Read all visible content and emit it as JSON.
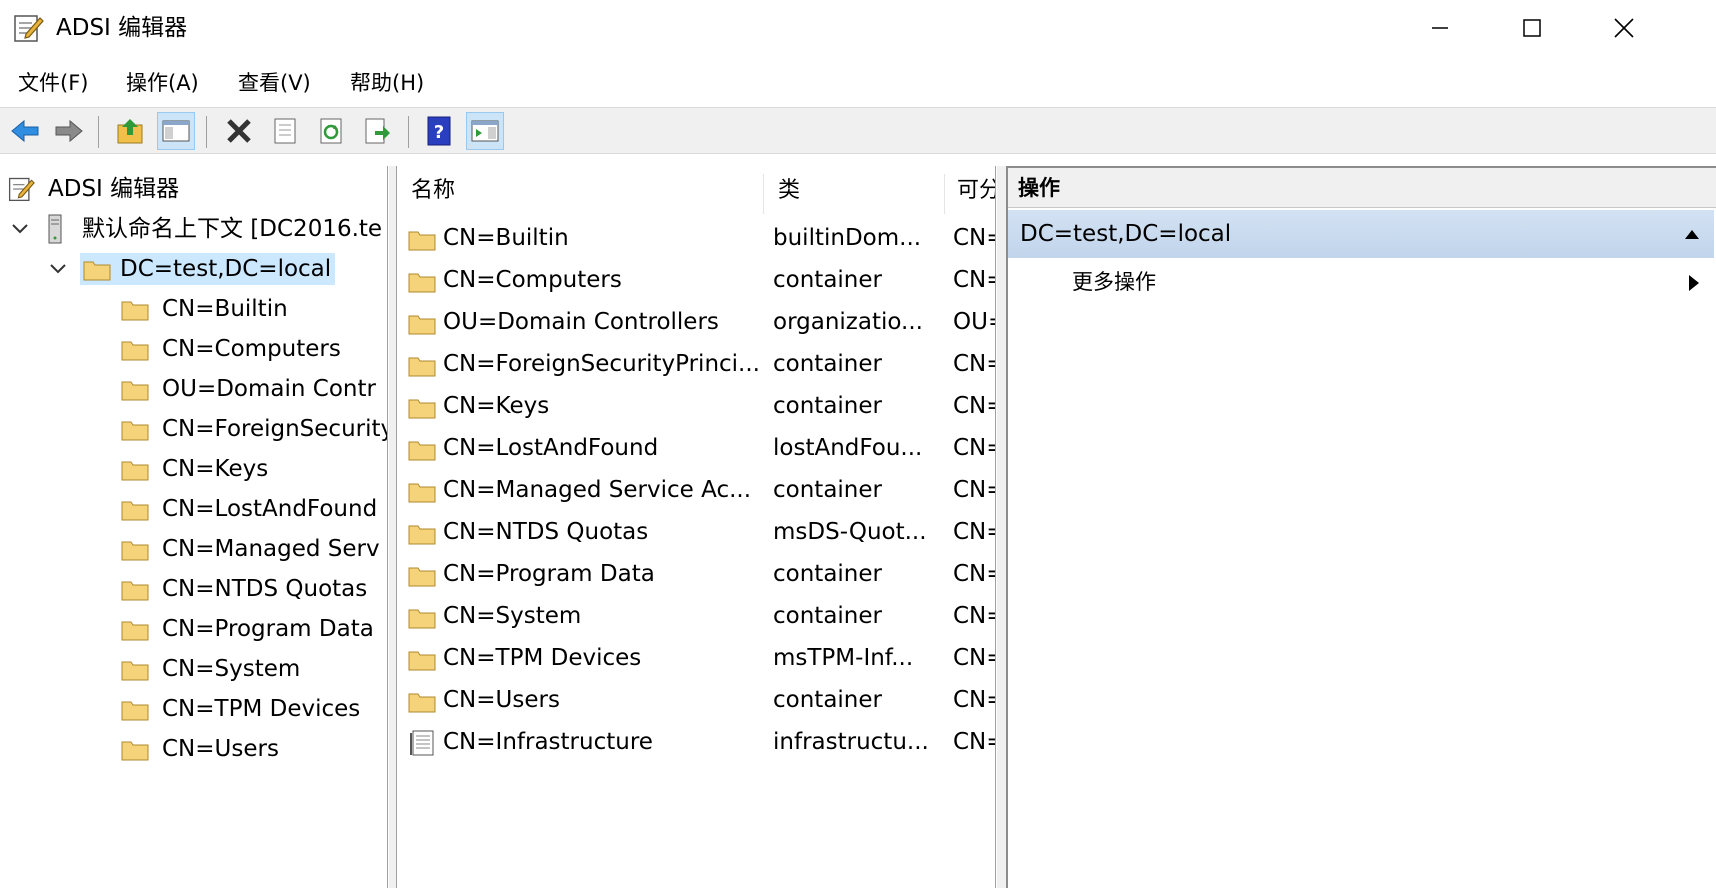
{
  "window": {
    "title": "ADSI 编辑器",
    "icons": {
      "app": "adsi-editor-icon",
      "minimize": "minimize-icon",
      "maximize": "maximize-icon",
      "close": "close-icon"
    }
  },
  "menu": {
    "items": [
      {
        "label": "文件(F)"
      },
      {
        "label": "操作(A)"
      },
      {
        "label": "查看(V)"
      },
      {
        "label": "帮助(H)"
      }
    ]
  },
  "toolbar": {
    "buttons": [
      {
        "icon": "back-arrow-icon"
      },
      {
        "icon": "forward-arrow-icon"
      },
      {
        "icon": "up-folder-icon"
      },
      {
        "icon": "show-hide-console-tree-icon",
        "active": true
      },
      {
        "icon": "delete-x-icon"
      },
      {
        "icon": "properties-icon"
      },
      {
        "icon": "refresh-icon"
      },
      {
        "icon": "export-list-icon"
      },
      {
        "icon": "help-icon"
      },
      {
        "icon": "show-hide-action-pane-icon",
        "active": true
      }
    ]
  },
  "tree": {
    "root": {
      "label": "ADSI 编辑器",
      "icon": "adsi-editor-icon"
    },
    "context": {
      "label": "默认命名上下文 [DC2016.te",
      "icon": "server-icon"
    },
    "domain": {
      "label": "DC=test,DC=local",
      "icon": "folder-icon",
      "selected": true
    },
    "children": [
      {
        "label": "CN=Builtin"
      },
      {
        "label": "CN=Computers"
      },
      {
        "label": "OU=Domain Contr"
      },
      {
        "label": "CN=ForeignSecurity"
      },
      {
        "label": "CN=Keys"
      },
      {
        "label": "CN=LostAndFound"
      },
      {
        "label": "CN=Managed Serv"
      },
      {
        "label": "CN=NTDS Quotas"
      },
      {
        "label": "CN=Program Data"
      },
      {
        "label": "CN=System"
      },
      {
        "label": "CN=TPM Devices"
      },
      {
        "label": "CN=Users"
      }
    ]
  },
  "list": {
    "columns": [
      {
        "label": "名称"
      },
      {
        "label": "类"
      },
      {
        "label": "可分"
      }
    ],
    "rows": [
      {
        "name": "CN=Builtin",
        "class": "builtinDom...",
        "dn": "CN=",
        "icon": "folder-icon"
      },
      {
        "name": "CN=Computers",
        "class": "container",
        "dn": "CN=",
        "icon": "folder-icon"
      },
      {
        "name": "OU=Domain Controllers",
        "class": "organizatio...",
        "dn": "OU=",
        "icon": "folder-icon"
      },
      {
        "name": "CN=ForeignSecurityPrinci...",
        "class": "container",
        "dn": "CN=",
        "icon": "folder-icon"
      },
      {
        "name": "CN=Keys",
        "class": "container",
        "dn": "CN=",
        "icon": "folder-icon"
      },
      {
        "name": "CN=LostAndFound",
        "class": "lostAndFou...",
        "dn": "CN=",
        "icon": "folder-icon"
      },
      {
        "name": "CN=Managed Service Ac...",
        "class": "container",
        "dn": "CN=",
        "icon": "folder-icon"
      },
      {
        "name": "CN=NTDS Quotas",
        "class": "msDS-Quot...",
        "dn": "CN=",
        "icon": "folder-icon"
      },
      {
        "name": "CN=Program Data",
        "class": "container",
        "dn": "CN=",
        "icon": "folder-icon"
      },
      {
        "name": "CN=System",
        "class": "container",
        "dn": "CN=",
        "icon": "folder-icon"
      },
      {
        "name": "CN=TPM Devices",
        "class": "msTPM-Inf...",
        "dn": "CN=",
        "icon": "folder-icon"
      },
      {
        "name": "CN=Users",
        "class": "container",
        "dn": "CN=",
        "icon": "folder-icon"
      },
      {
        "name": "CN=Infrastructure",
        "class": "infrastructu...",
        "dn": "CN=",
        "icon": "document-icon"
      }
    ]
  },
  "actions": {
    "header": "操作",
    "section": {
      "label": "DC=test,DC=local",
      "icon": "collapse-up-triangle-icon"
    },
    "items": [
      {
        "label": "更多操作",
        "icon": "submenu-right-triangle-icon"
      }
    ]
  },
  "colors": {
    "selection": "#cce8ff",
    "toolbar": "#f0f0f0",
    "section": "#c9dbef",
    "folder": "#f5d37a"
  }
}
